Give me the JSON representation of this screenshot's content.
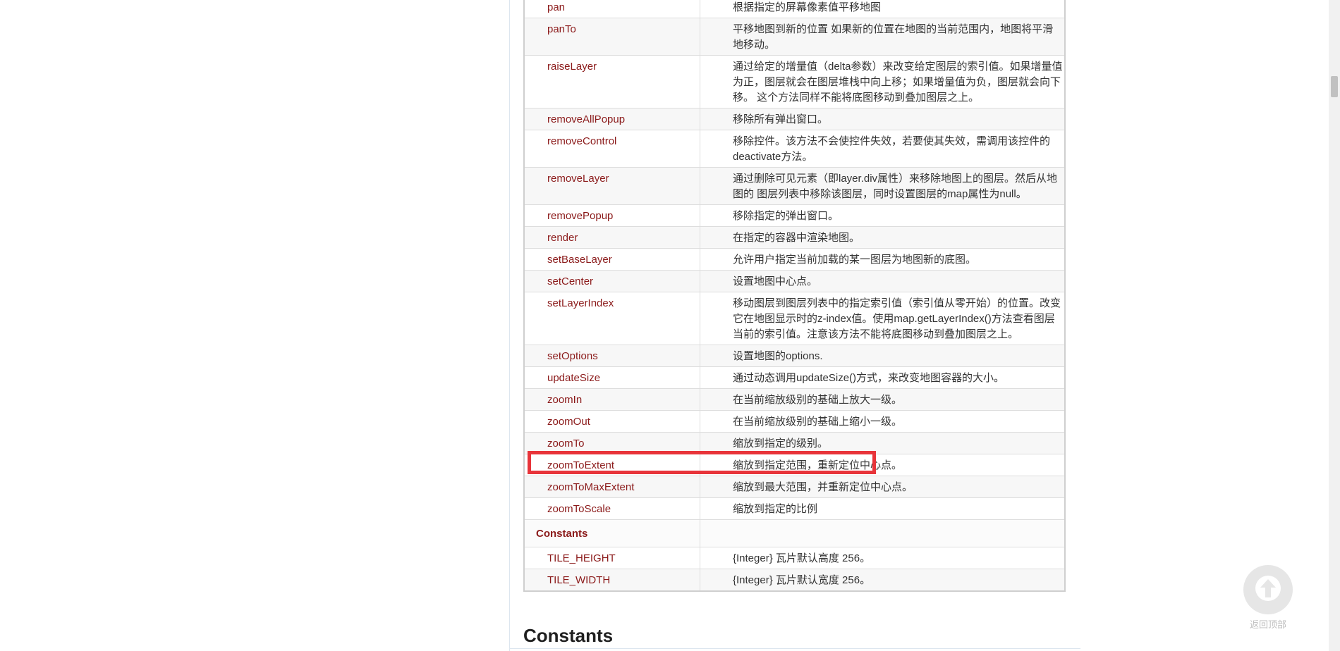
{
  "methods": [
    {
      "name": "pan",
      "desc": "根据指定的屏幕像素值平移地图"
    },
    {
      "name": "panTo",
      "desc": "平移地图到新的位置 如果新的位置在地图的当前范围内，地图将平滑地移动。"
    },
    {
      "name": "raiseLayer",
      "desc": "通过给定的增量值（delta参数）来改变给定图层的索引值。如果增量值为正，图层就会在图层堆栈中向上移；如果增量值为负，图层就会向下移。 这个方法同样不能将底图移动到叠加图层之上。"
    },
    {
      "name": "removeAllPopup",
      "desc": "移除所有弹出窗口。"
    },
    {
      "name": "removeControl",
      "desc": "移除控件。该方法不会使控件失效，若要使其失效，需调用该控件的deactivate方法。"
    },
    {
      "name": "removeLayer",
      "desc": "通过删除可见元素（即layer.div属性）来移除地图上的图层。然后从地图的 图层列表中移除该图层，同时设置图层的map属性为null。"
    },
    {
      "name": "removePopup",
      "desc": "移除指定的弹出窗口。"
    },
    {
      "name": "render",
      "desc": "在指定的容器中渲染地图。"
    },
    {
      "name": "setBaseLayer",
      "desc": "允许用户指定当前加载的某一图层为地图新的底图。"
    },
    {
      "name": "setCenter",
      "desc": "设置地图中心点。"
    },
    {
      "name": "setLayerIndex",
      "desc": "移动图层到图层列表中的指定索引值（索引值从零开始）的位置。改变 它在地图显示时的z-index值。使用map.getLayerIndex()方法查看图层 当前的索引值。注意该方法不能将底图移动到叠加图层之上。"
    },
    {
      "name": "setOptions",
      "desc": "设置地图的options."
    },
    {
      "name": "updateSize",
      "desc": "通过动态调用updateSize()方式，来改变地图容器的大小。"
    },
    {
      "name": "zoomIn",
      "desc": "在当前缩放级别的基础上放大一级。"
    },
    {
      "name": "zoomOut",
      "desc": "在当前缩放级别的基础上缩小一级。"
    },
    {
      "name": "zoomTo",
      "desc": "缩放到指定的级别。"
    },
    {
      "name": "zoomToExtent",
      "desc": "缩放到指定范围，重新定位中心点。"
    },
    {
      "name": "zoomToMaxExtent",
      "desc": "缩放到最大范围，并重新定位中心点。"
    },
    {
      "name": "zoomToScale",
      "desc": "缩放到指定的比例"
    }
  ],
  "constants_section_label": "Constants",
  "constants": [
    {
      "name": "TILE_HEIGHT",
      "desc": "{Integer} 瓦片默认高度 256。"
    },
    {
      "name": "TILE_WIDTH",
      "desc": "{Integer} 瓦片默认宽度 256。"
    }
  ],
  "heading": "Constants",
  "back_to_top": {
    "label": "返回顶部",
    "icon": "arrow-up-icon"
  },
  "highlight": {
    "target": "zoomToExtent",
    "color": "#e8343a"
  }
}
